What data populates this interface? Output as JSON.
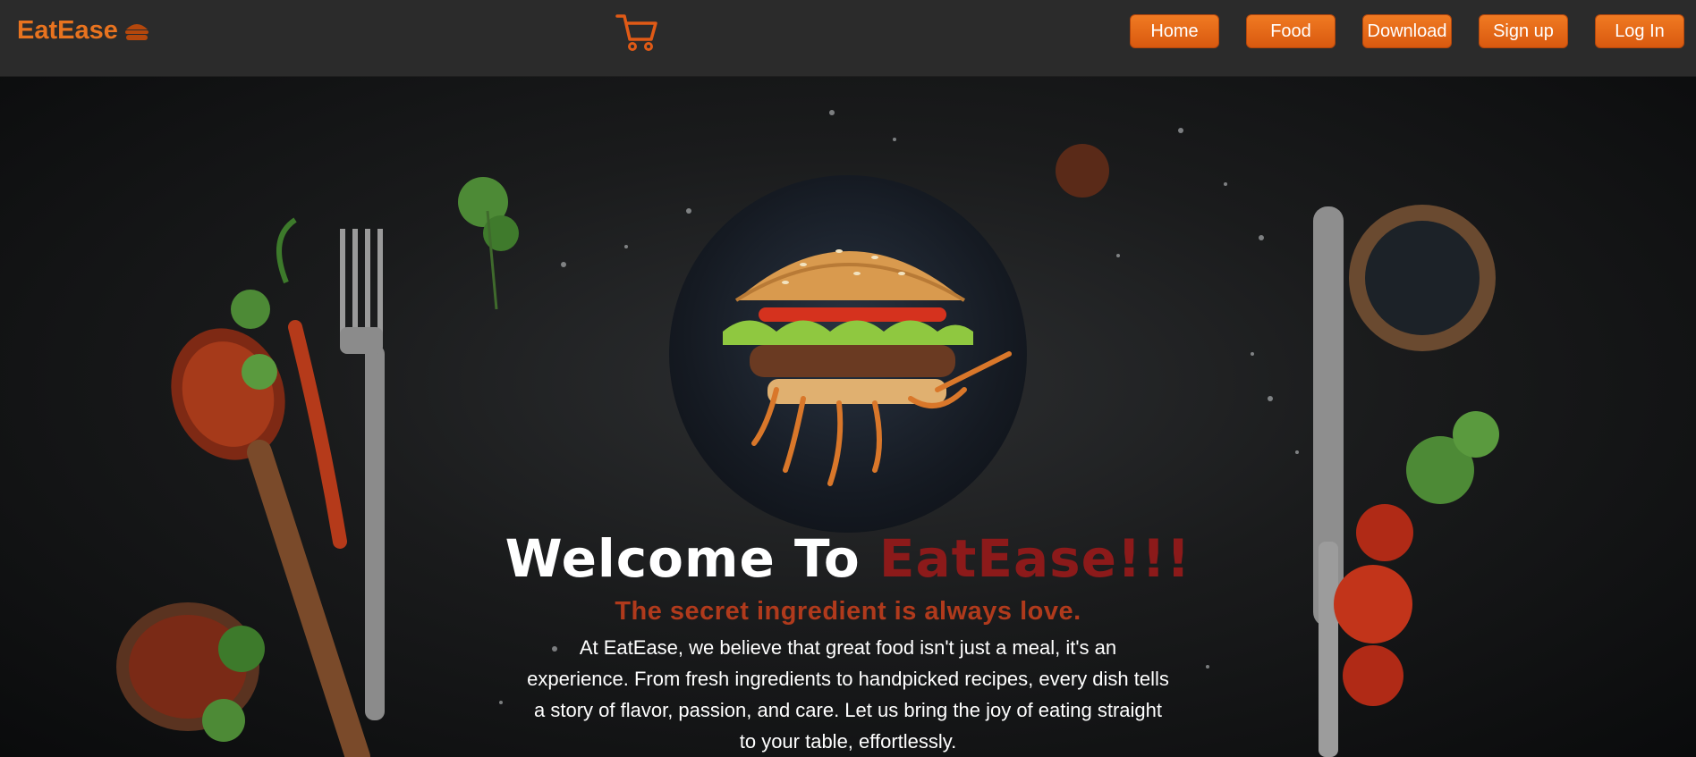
{
  "brand": {
    "name": "EatEase",
    "icon": "burger-icon",
    "color": "#e8731f"
  },
  "header": {
    "cart_icon": "shopping-cart-icon"
  },
  "nav": {
    "items": [
      {
        "label": "Home"
      },
      {
        "label": "Food"
      },
      {
        "label": "Download"
      },
      {
        "label": "Sign up"
      },
      {
        "label": "Log In"
      }
    ],
    "button_color": "#ea6c1b"
  },
  "hero": {
    "welcome_prefix": "Welcome To ",
    "welcome_brand": "EatEase!!!",
    "tagline": "The secret ingredient is always love.",
    "description": "At EatEase, we believe that great food isn't just a meal, it's an experience. From fresh ingredients to handpicked recipes, every dish tells a story of flavor, passion, and care. Let us bring the joy of eating straight to your table, effortlessly.",
    "accent_color": "#8c1a1a",
    "tagline_color": "#b03a1c"
  }
}
